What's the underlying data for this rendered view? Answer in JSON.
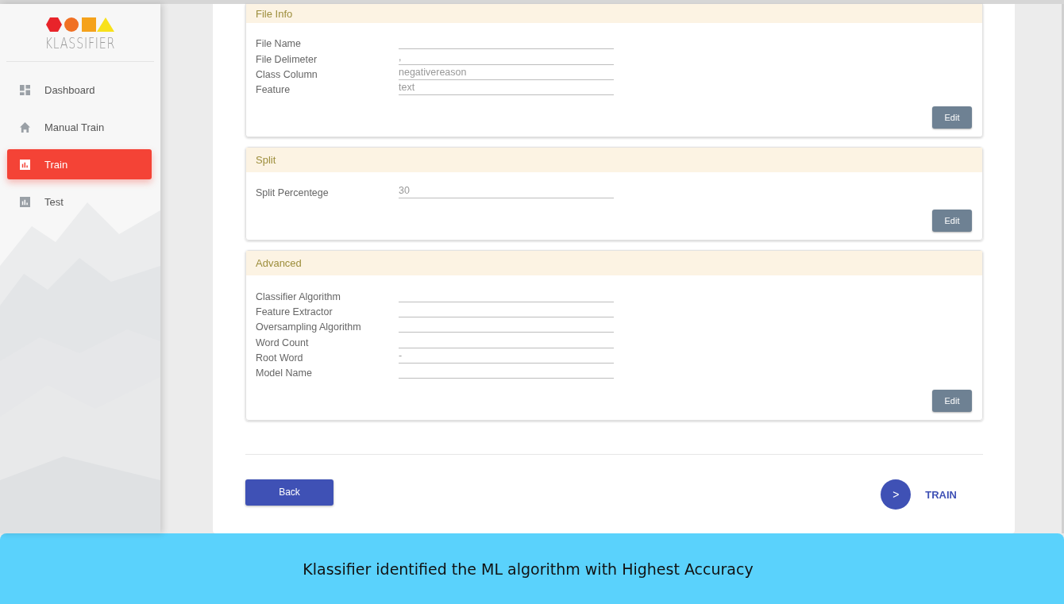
{
  "sidebar": {
    "logo": "KLASSIFIER",
    "items": [
      {
        "label": "Dashboard",
        "kind": "dashboard",
        "selected": false
      },
      {
        "label": "Manual Train",
        "kind": "home",
        "selected": false
      },
      {
        "label": "Train",
        "kind": "chart",
        "selected": true
      },
      {
        "label": "Test",
        "kind": "chart",
        "selected": false
      }
    ]
  },
  "sections": [
    {
      "title": "File Info",
      "fields": [
        {
          "label": "File Name"
        },
        {
          "label": "File Delimeter",
          "value": ","
        },
        {
          "label": "Class Column",
          "value": "negativereason"
        },
        {
          "label": "Feature",
          "value": "text"
        }
      ],
      "button": "Edit"
    },
    {
      "title": "Split",
      "fields": [
        {
          "label": "Split Percentege",
          "value": "30"
        }
      ],
      "button": "Edit"
    },
    {
      "title": "Advanced",
      "fields": [
        {
          "label": "Classifier Algorithm"
        },
        {
          "label": "Feature Extractor"
        },
        {
          "label": "Oversampling Algorithm"
        },
        {
          "label": "Word Count"
        },
        {
          "label": "Root Word",
          "value": "-"
        },
        {
          "label": "Model Name"
        }
      ],
      "button": "Edit"
    }
  ],
  "footer": {
    "back": "Back",
    "next_icon": ">",
    "next": "TRAIN"
  },
  "banner": "Klassifier identified the ML algorithm with Highest Accuracy"
}
